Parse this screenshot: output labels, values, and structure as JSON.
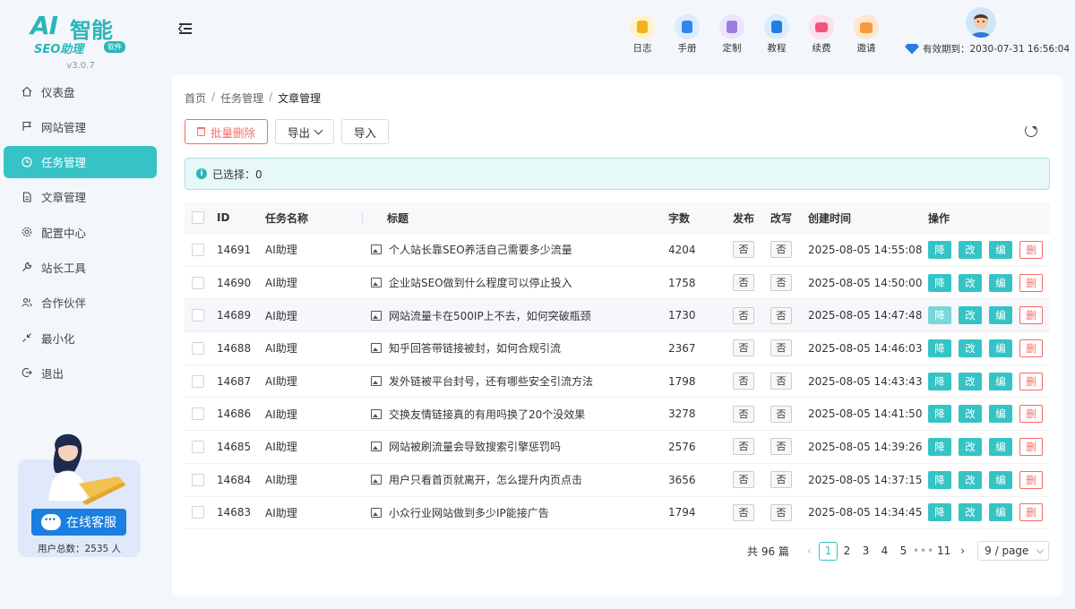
{
  "brand": {
    "logo_ai": "AI",
    "logo_cn": "智能",
    "logo_seo": "SEO助理",
    "logo_badge": "软件",
    "version": "v3.0.7"
  },
  "sidebar": {
    "items": [
      {
        "label": "仪表盘",
        "icon": "home-icon",
        "active": false
      },
      {
        "label": "网站管理",
        "icon": "flag-icon",
        "active": false
      },
      {
        "label": "任务管理",
        "icon": "clock-icon",
        "active": true
      },
      {
        "label": "文章管理",
        "icon": "document-icon",
        "active": false
      },
      {
        "label": "配置中心",
        "icon": "gear-icon",
        "active": false
      },
      {
        "label": "站长工具",
        "icon": "wrench-icon",
        "active": false
      },
      {
        "label": "合作伙伴",
        "icon": "users-icon",
        "active": false
      },
      {
        "label": "最小化",
        "icon": "minimize-icon",
        "active": false
      },
      {
        "label": "退出",
        "icon": "logout-icon",
        "active": false
      }
    ],
    "service_button": "在线客服",
    "user_count": "用户总数：2535 人"
  },
  "header": {
    "tools": [
      {
        "label": "日志",
        "icon": "log-icon",
        "bg": "#fff3cf",
        "fg": "#f5b21c"
      },
      {
        "label": "手册",
        "icon": "manual-icon",
        "bg": "#dcecff",
        "fg": "#2f86f0"
      },
      {
        "label": "定制",
        "icon": "custom-icon",
        "bg": "#ece4fb",
        "fg": "#9a7ce0"
      },
      {
        "label": "教程",
        "icon": "tutorial-icon",
        "bg": "#dcecff",
        "fg": "#1f7fe6"
      },
      {
        "label": "续费",
        "icon": "renew-icon",
        "bg": "#fde0ea",
        "fg": "#f0557e"
      },
      {
        "label": "邀请",
        "icon": "invite-icon",
        "bg": "#ffe6cf",
        "fg": "#f59a3a"
      }
    ],
    "expire_text": "有效期到：2030-07-31 16:56:04"
  },
  "breadcrumb": [
    "首页",
    "任务管理",
    "文章管理"
  ],
  "toolbar": {
    "batch_delete": "批量删除",
    "export": "导出",
    "import": "导入"
  },
  "alert": {
    "selected_text": "已选择：0"
  },
  "table": {
    "headers": {
      "id": "ID",
      "task": "任务名称",
      "title": "标题",
      "words": "字数",
      "publish": "发布",
      "rewrite": "改写",
      "created": "创建时间",
      "ops": "操作"
    },
    "rows": [
      {
        "id": "14691",
        "task": "AI助理",
        "title": "个人站长靠SEO养活自己需要多少流量",
        "words": "4204",
        "publish": "否",
        "rewrite": "否",
        "created": "2025-08-05 14:55:08"
      },
      {
        "id": "14690",
        "task": "AI助理",
        "title": "企业站SEO做到什么程度可以停止投入",
        "words": "1758",
        "publish": "否",
        "rewrite": "否",
        "created": "2025-08-05 14:50:00"
      },
      {
        "id": "14689",
        "task": "AI助理",
        "title": "网站流量卡在500IP上不去，如何突破瓶颈",
        "words": "1730",
        "publish": "否",
        "rewrite": "否",
        "created": "2025-08-05 14:47:48"
      },
      {
        "id": "14688",
        "task": "AI助理",
        "title": "知乎回答带链接被封，如何合规引流",
        "words": "2367",
        "publish": "否",
        "rewrite": "否",
        "created": "2025-08-05 14:46:03"
      },
      {
        "id": "14687",
        "task": "AI助理",
        "title": "发外链被平台封号，还有哪些安全引流方法",
        "words": "1798",
        "publish": "否",
        "rewrite": "否",
        "created": "2025-08-05 14:43:43"
      },
      {
        "id": "14686",
        "task": "AI助理",
        "title": "交换友情链接真的有用吗换了20个没效果",
        "words": "3278",
        "publish": "否",
        "rewrite": "否",
        "created": "2025-08-05 14:41:50"
      },
      {
        "id": "14685",
        "task": "AI助理",
        "title": "网站被刷流量会导致搜索引擎惩罚吗",
        "words": "2576",
        "publish": "否",
        "rewrite": "否",
        "created": "2025-08-05 14:39:26"
      },
      {
        "id": "14684",
        "task": "AI助理",
        "title": "用户只看首页就离开，怎么提升内页点击",
        "words": "3656",
        "publish": "否",
        "rewrite": "否",
        "created": "2025-08-05 14:37:15"
      },
      {
        "id": "14683",
        "task": "AI助理",
        "title": "小众行业网站做到多少IP能接广告",
        "words": "1794",
        "publish": "否",
        "rewrite": "否",
        "created": "2025-08-05 14:34:45"
      }
    ],
    "op_labels": {
      "down": "降",
      "rewrite": "改",
      "edit": "编",
      "delete": "删"
    }
  },
  "pagination": {
    "total": "共 96 篇",
    "pages": [
      "1",
      "2",
      "3",
      "4",
      "5",
      "•••",
      "11"
    ],
    "current": "1",
    "page_size": "9 / page"
  },
  "colors": {
    "accent": "#35c3c5",
    "danger": "#f56c6c",
    "service_blue": "#1a7fe0"
  }
}
